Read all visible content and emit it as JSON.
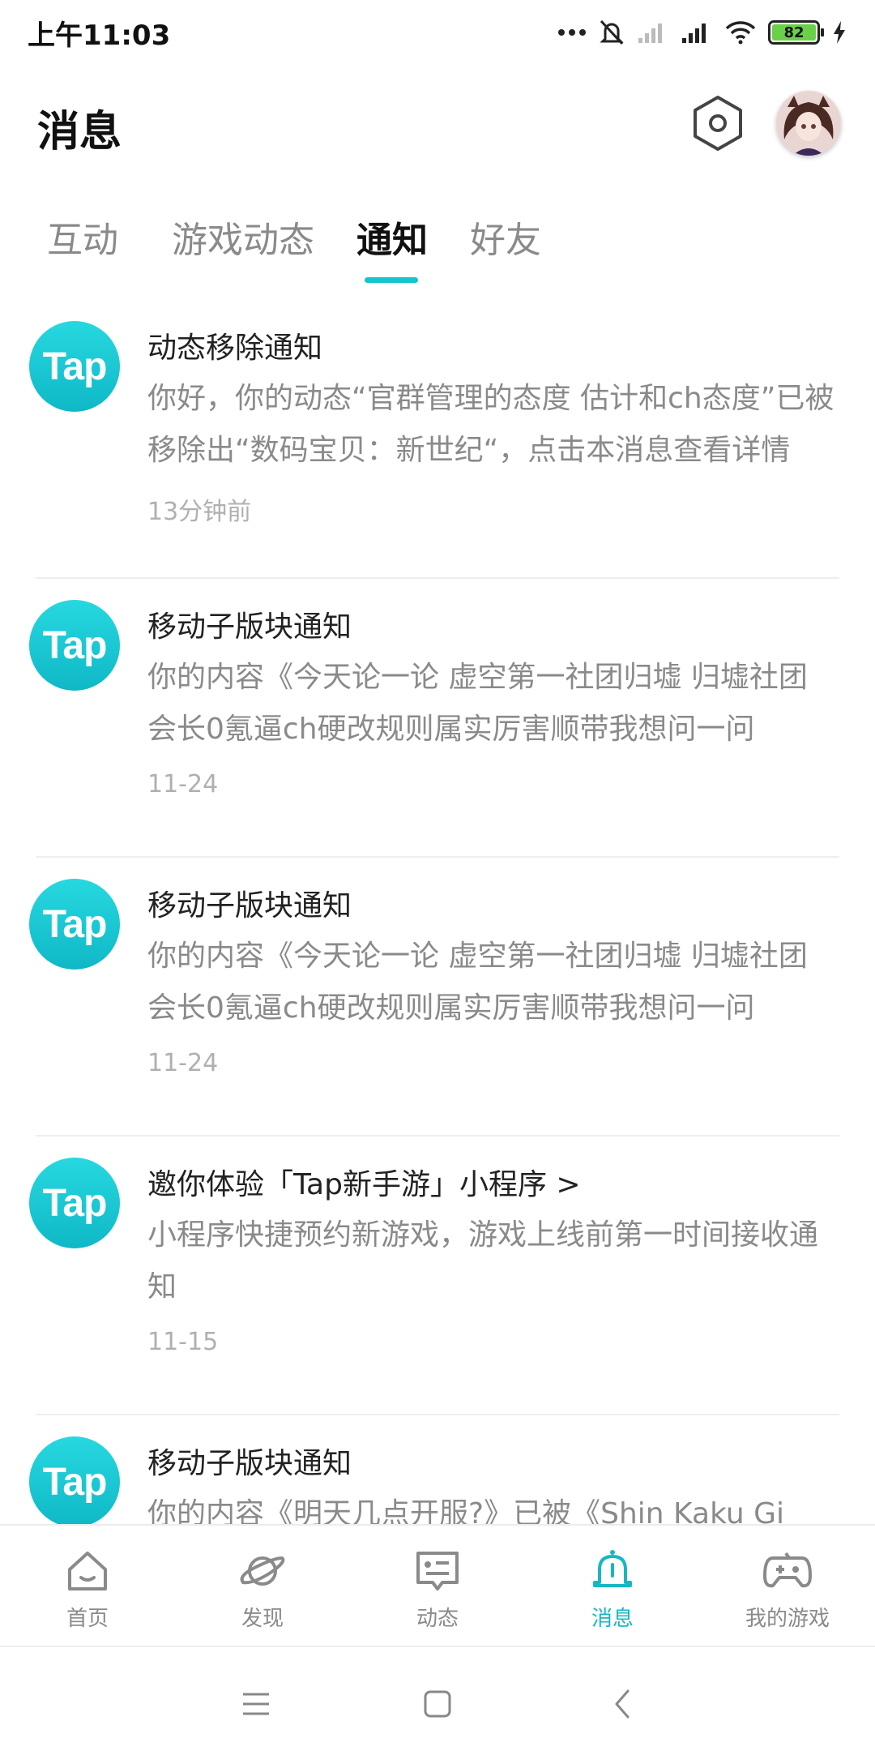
{
  "status_bar": {
    "time": "上午11:03",
    "battery": "82",
    "icons": [
      "more-dots-icon",
      "bell-muted-icon",
      "signal-weak-icon",
      "signal-icon",
      "wifi-icon",
      "battery-icon",
      "charging-icon"
    ]
  },
  "header": {
    "title": "消息",
    "settings_icon": "hexagon-settings-icon",
    "avatar": "user-avatar"
  },
  "tabs": [
    {
      "label": "互动",
      "active": false
    },
    {
      "label": "游戏动态",
      "active": false
    },
    {
      "label": "通知",
      "active": true
    },
    {
      "label": "好友",
      "active": false
    }
  ],
  "notifications": [
    {
      "logo": "Tap",
      "title": "动态移除通知",
      "body": "你好，你的动态“官群管理的态度 估计和ch态度”已被移除出“数码宝贝：新世纪“，点击本消息查看详情",
      "time": "13分钟前"
    },
    {
      "logo": "Tap",
      "title": "移动子版块通知",
      "body": "你的内容《今天论一论 虚空第一社团归墟 归墟社团会长0氪逼ch硬改规则属实厉害顺带我想问一问",
      "time": "11-24"
    },
    {
      "logo": "Tap",
      "title": "移动子版块通知",
      "body": "你的内容《今天论一论 虚空第一社团归墟 归墟社团会长0氪逼ch硬改规则属实厉害顺带我想问一问",
      "time": "11-24"
    },
    {
      "logo": "Tap",
      "title": "邀你体验「Tap新手游」小程序 >",
      "body": "小程序快捷预约新游戏，游戏上线前第一时间接收通知",
      "time": "11-15"
    },
    {
      "logo": "Tap",
      "title": "移动子版块通知",
      "body": "你的内容《明天几点开服?》已被《Shin Kaku Gi",
      "time": ""
    }
  ],
  "bottom_nav": [
    {
      "label": "首页",
      "icon": "home-icon",
      "active": false
    },
    {
      "label": "发现",
      "icon": "planet-icon",
      "active": false
    },
    {
      "label": "动态",
      "icon": "chat-card-icon",
      "active": false
    },
    {
      "label": "消息",
      "icon": "bell-icon",
      "active": true
    },
    {
      "label": "我的游戏",
      "icon": "gamepad-icon",
      "active": false
    }
  ],
  "colors": {
    "accent": "#15c5ce",
    "text_primary": "#222222",
    "text_secondary": "#8a8a8a"
  }
}
